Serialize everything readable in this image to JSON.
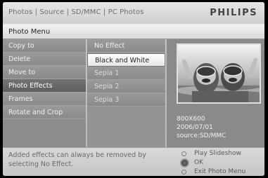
{
  "header": {
    "breadcrumb": "Photos | Source | SD/MMC | PC Photos",
    "brand": "PHILIPS"
  },
  "menu": {
    "title": "Photo Menu"
  },
  "menu_items": [
    {
      "label": "Copy to"
    },
    {
      "label": "Delete"
    },
    {
      "label": "Move to"
    },
    {
      "label": "Photo Effects",
      "selected": true
    },
    {
      "label": "Frames"
    },
    {
      "label": "Rotate and Crop"
    }
  ],
  "effects": [
    {
      "label": "No Effect"
    },
    {
      "label": "Black and White",
      "selected": true
    },
    {
      "label": "Sepia 1"
    },
    {
      "label": "Sepia 2"
    },
    {
      "label": "Sepia 3"
    }
  ],
  "preview": {
    "resolution": "800X600",
    "date": "2006/07/01",
    "source": "source:SD/MMC"
  },
  "footer": {
    "hint": "Added effects can always be removed by selecting No Effect.",
    "controls": [
      {
        "label": "Play Slideshow",
        "icon": "radio-ring"
      },
      {
        "label": "OK",
        "icon": "ok-button"
      },
      {
        "label": "Exit Photo Menu",
        "icon": "radio-ring"
      }
    ]
  }
}
